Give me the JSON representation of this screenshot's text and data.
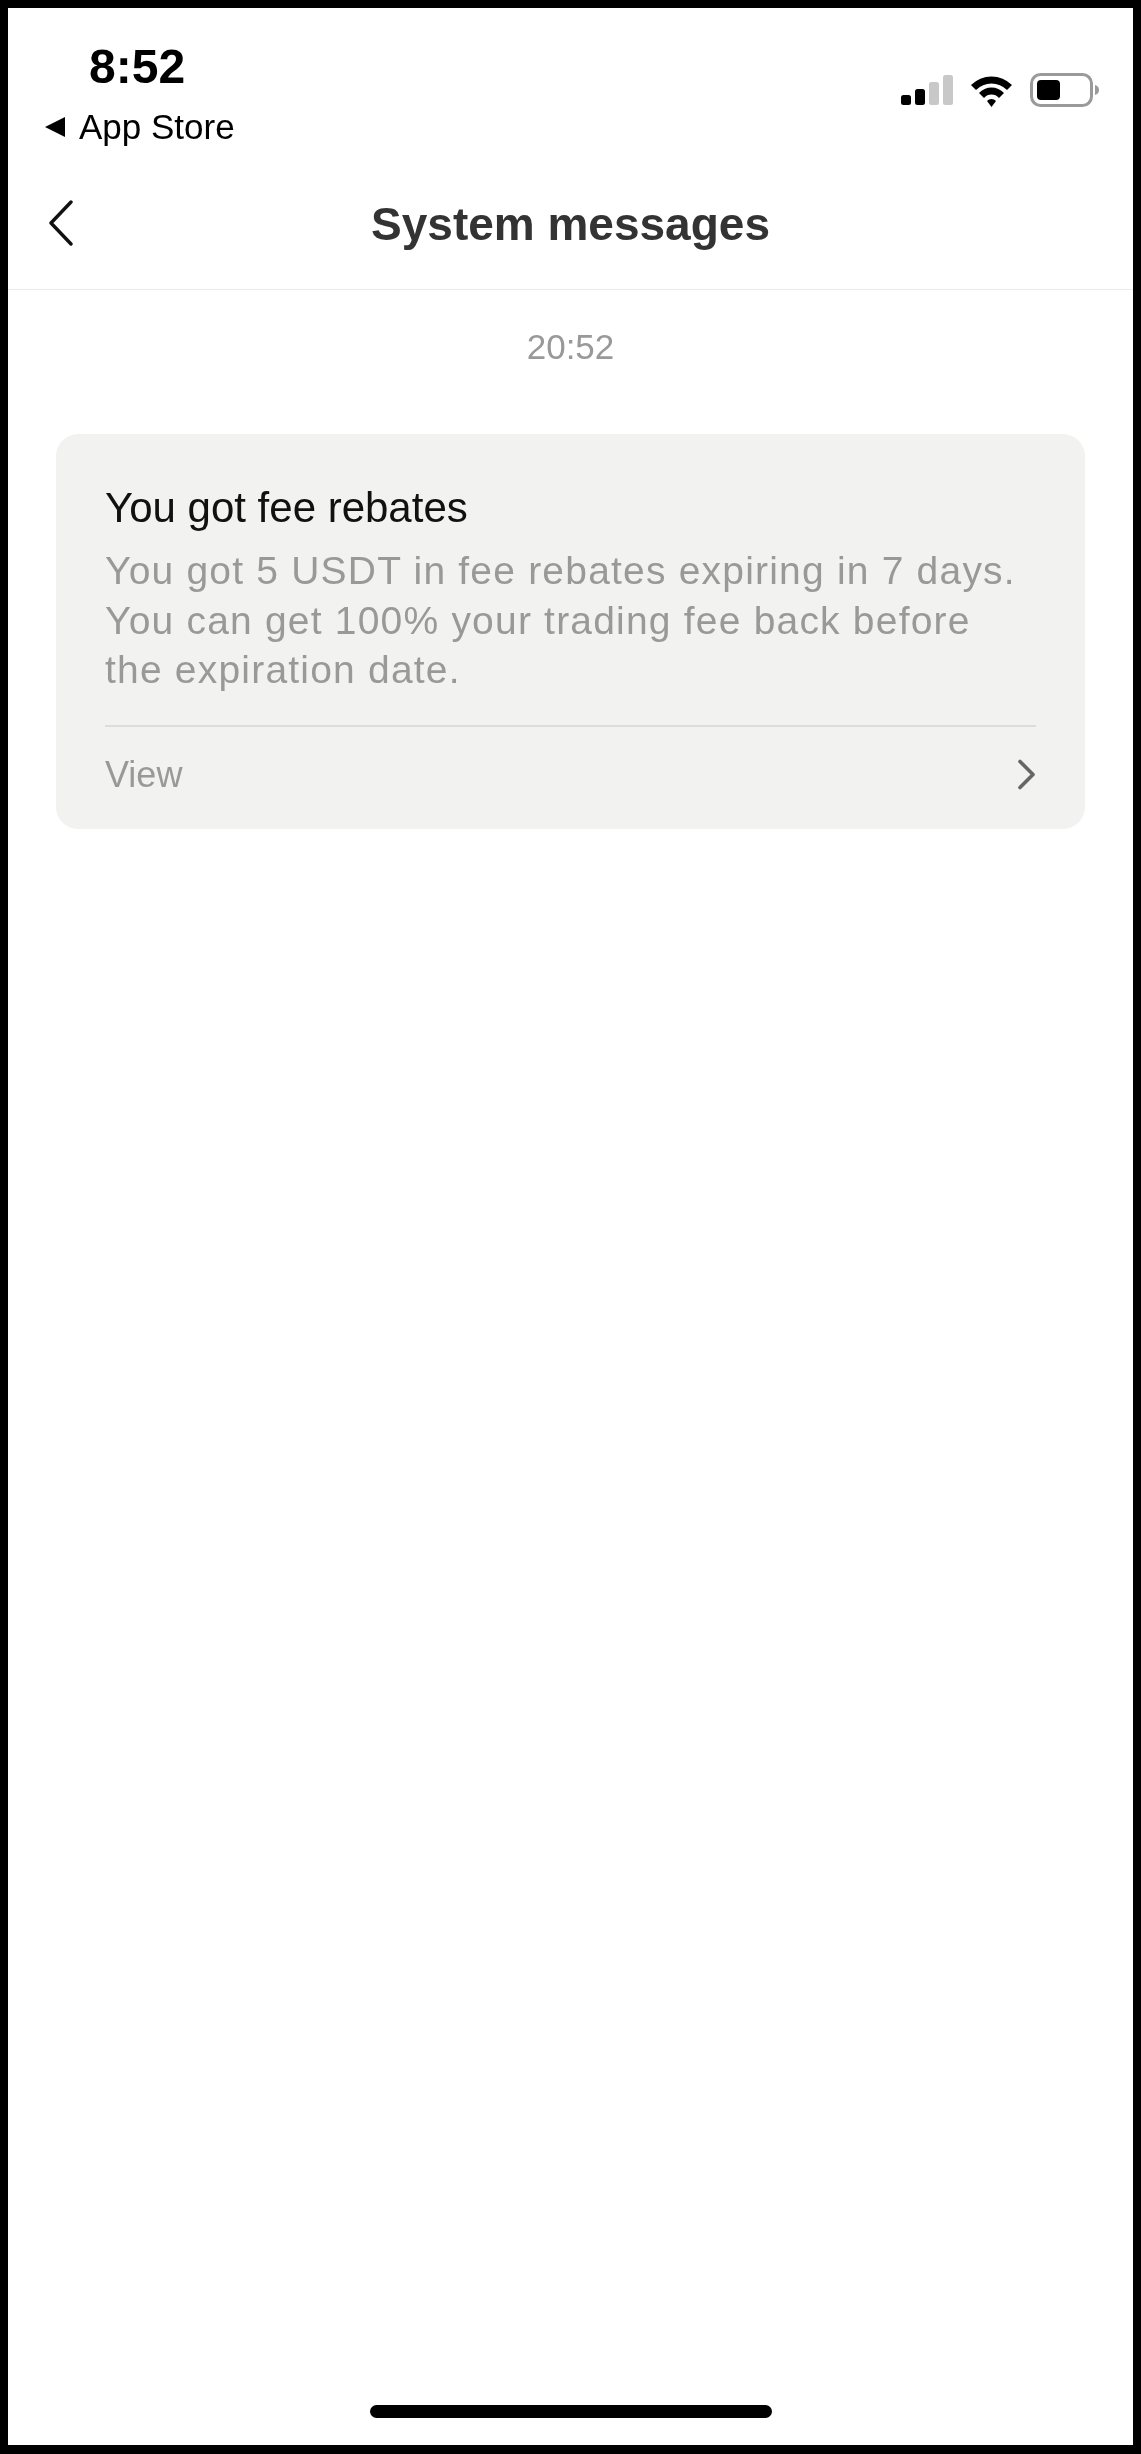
{
  "status_bar": {
    "time": "8:52",
    "back_link": "App Store"
  },
  "header": {
    "title": "System messages"
  },
  "messages": [
    {
      "timestamp": "20:52",
      "title": "You got fee rebates",
      "body": "You got 5 USDT in fee rebates expiring in 7 days. You can get 100% your trading fee back before the expiration date.",
      "action": "View"
    }
  ]
}
